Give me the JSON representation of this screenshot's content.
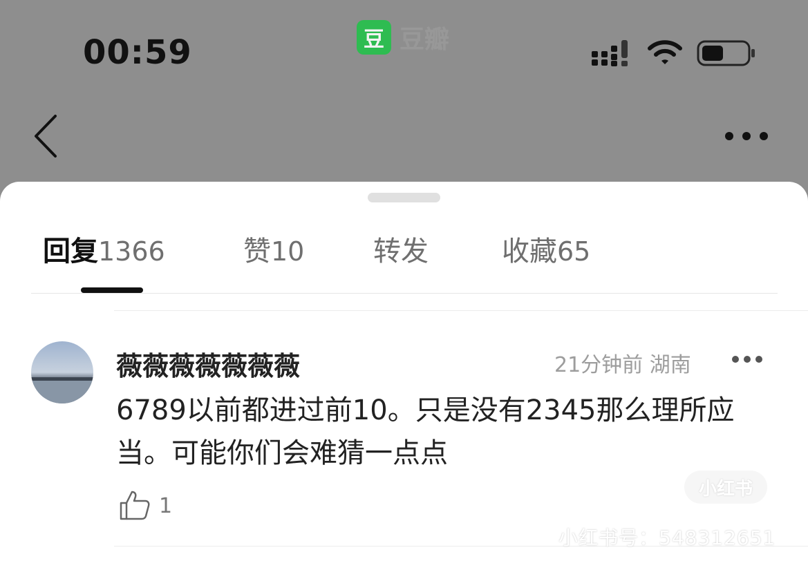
{
  "status_bar": {
    "time": "00:59",
    "app_logo_char": "豆",
    "app_name": "豆瓣"
  },
  "nav": {
    "back_icon": "chevron-left-icon",
    "more_icon": "ellipsis-icon"
  },
  "tabs": [
    {
      "label": "回复",
      "count": "1366",
      "active": true
    },
    {
      "label": "赞",
      "count": "10",
      "active": false
    },
    {
      "label": "转发",
      "count": "",
      "active": false
    },
    {
      "label": "收藏",
      "count": "65",
      "active": false
    }
  ],
  "comment": {
    "username": "薇薇薇薇薇薇薇",
    "time_location": "21分钟前 湖南",
    "text": "6789以前都进过前10。只是没有2345那么理所应当。可能你们会难猜一点点",
    "like_count": "1"
  },
  "watermark": {
    "badge": "小红书",
    "id_text": "小红书号：548312651"
  }
}
